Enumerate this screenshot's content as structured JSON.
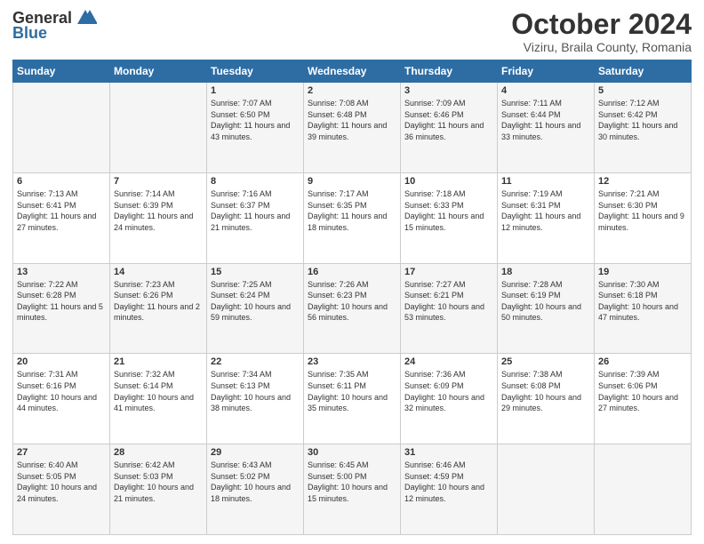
{
  "header": {
    "logo_general": "General",
    "logo_blue": "Blue",
    "month_title": "October 2024",
    "subtitle": "Viziru, Braila County, Romania"
  },
  "days_of_week": [
    "Sunday",
    "Monday",
    "Tuesday",
    "Wednesday",
    "Thursday",
    "Friday",
    "Saturday"
  ],
  "weeks": [
    [
      {
        "day": "",
        "info": ""
      },
      {
        "day": "",
        "info": ""
      },
      {
        "day": "1",
        "info": "Sunrise: 7:07 AM\nSunset: 6:50 PM\nDaylight: 11 hours and 43 minutes."
      },
      {
        "day": "2",
        "info": "Sunrise: 7:08 AM\nSunset: 6:48 PM\nDaylight: 11 hours and 39 minutes."
      },
      {
        "day": "3",
        "info": "Sunrise: 7:09 AM\nSunset: 6:46 PM\nDaylight: 11 hours and 36 minutes."
      },
      {
        "day": "4",
        "info": "Sunrise: 7:11 AM\nSunset: 6:44 PM\nDaylight: 11 hours and 33 minutes."
      },
      {
        "day": "5",
        "info": "Sunrise: 7:12 AM\nSunset: 6:42 PM\nDaylight: 11 hours and 30 minutes."
      }
    ],
    [
      {
        "day": "6",
        "info": "Sunrise: 7:13 AM\nSunset: 6:41 PM\nDaylight: 11 hours and 27 minutes."
      },
      {
        "day": "7",
        "info": "Sunrise: 7:14 AM\nSunset: 6:39 PM\nDaylight: 11 hours and 24 minutes."
      },
      {
        "day": "8",
        "info": "Sunrise: 7:16 AM\nSunset: 6:37 PM\nDaylight: 11 hours and 21 minutes."
      },
      {
        "day": "9",
        "info": "Sunrise: 7:17 AM\nSunset: 6:35 PM\nDaylight: 11 hours and 18 minutes."
      },
      {
        "day": "10",
        "info": "Sunrise: 7:18 AM\nSunset: 6:33 PM\nDaylight: 11 hours and 15 minutes."
      },
      {
        "day": "11",
        "info": "Sunrise: 7:19 AM\nSunset: 6:31 PM\nDaylight: 11 hours and 12 minutes."
      },
      {
        "day": "12",
        "info": "Sunrise: 7:21 AM\nSunset: 6:30 PM\nDaylight: 11 hours and 9 minutes."
      }
    ],
    [
      {
        "day": "13",
        "info": "Sunrise: 7:22 AM\nSunset: 6:28 PM\nDaylight: 11 hours and 5 minutes."
      },
      {
        "day": "14",
        "info": "Sunrise: 7:23 AM\nSunset: 6:26 PM\nDaylight: 11 hours and 2 minutes."
      },
      {
        "day": "15",
        "info": "Sunrise: 7:25 AM\nSunset: 6:24 PM\nDaylight: 10 hours and 59 minutes."
      },
      {
        "day": "16",
        "info": "Sunrise: 7:26 AM\nSunset: 6:23 PM\nDaylight: 10 hours and 56 minutes."
      },
      {
        "day": "17",
        "info": "Sunrise: 7:27 AM\nSunset: 6:21 PM\nDaylight: 10 hours and 53 minutes."
      },
      {
        "day": "18",
        "info": "Sunrise: 7:28 AM\nSunset: 6:19 PM\nDaylight: 10 hours and 50 minutes."
      },
      {
        "day": "19",
        "info": "Sunrise: 7:30 AM\nSunset: 6:18 PM\nDaylight: 10 hours and 47 minutes."
      }
    ],
    [
      {
        "day": "20",
        "info": "Sunrise: 7:31 AM\nSunset: 6:16 PM\nDaylight: 10 hours and 44 minutes."
      },
      {
        "day": "21",
        "info": "Sunrise: 7:32 AM\nSunset: 6:14 PM\nDaylight: 10 hours and 41 minutes."
      },
      {
        "day": "22",
        "info": "Sunrise: 7:34 AM\nSunset: 6:13 PM\nDaylight: 10 hours and 38 minutes."
      },
      {
        "day": "23",
        "info": "Sunrise: 7:35 AM\nSunset: 6:11 PM\nDaylight: 10 hours and 35 minutes."
      },
      {
        "day": "24",
        "info": "Sunrise: 7:36 AM\nSunset: 6:09 PM\nDaylight: 10 hours and 32 minutes."
      },
      {
        "day": "25",
        "info": "Sunrise: 7:38 AM\nSunset: 6:08 PM\nDaylight: 10 hours and 29 minutes."
      },
      {
        "day": "26",
        "info": "Sunrise: 7:39 AM\nSunset: 6:06 PM\nDaylight: 10 hours and 27 minutes."
      }
    ],
    [
      {
        "day": "27",
        "info": "Sunrise: 6:40 AM\nSunset: 5:05 PM\nDaylight: 10 hours and 24 minutes."
      },
      {
        "day": "28",
        "info": "Sunrise: 6:42 AM\nSunset: 5:03 PM\nDaylight: 10 hours and 21 minutes."
      },
      {
        "day": "29",
        "info": "Sunrise: 6:43 AM\nSunset: 5:02 PM\nDaylight: 10 hours and 18 minutes."
      },
      {
        "day": "30",
        "info": "Sunrise: 6:45 AM\nSunset: 5:00 PM\nDaylight: 10 hours and 15 minutes."
      },
      {
        "day": "31",
        "info": "Sunrise: 6:46 AM\nSunset: 4:59 PM\nDaylight: 10 hours and 12 minutes."
      },
      {
        "day": "",
        "info": ""
      },
      {
        "day": "",
        "info": ""
      }
    ]
  ]
}
